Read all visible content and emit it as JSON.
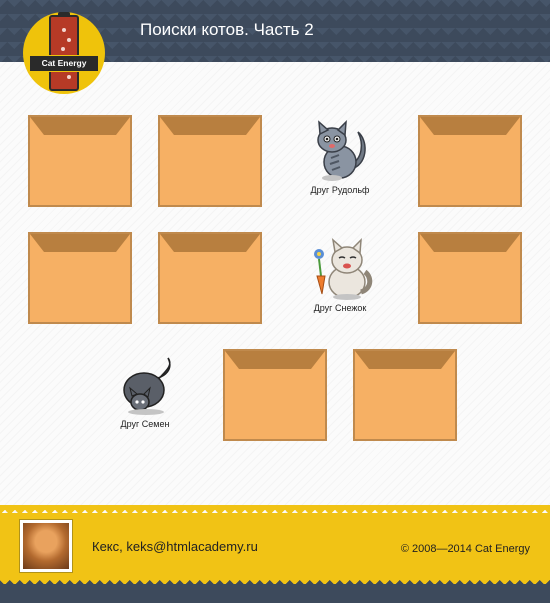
{
  "header": {
    "logo_text": "Cat Energy",
    "title": "Поиски котов. Часть 2"
  },
  "game": {
    "friends": [
      {
        "name": "Друг Рудольф"
      },
      {
        "name": "Друг Снежок"
      },
      {
        "name": "Друг Семен"
      }
    ]
  },
  "footer": {
    "user": "Кекс, keks@htmlacademy.ru",
    "copyright": "© 2008—2014 Cat Energy"
  },
  "colors": {
    "header_bg": "#3d4a5c",
    "accent_yellow": "#f1c315",
    "card_fill": "#f6b064",
    "card_flap": "#b87f3f"
  }
}
